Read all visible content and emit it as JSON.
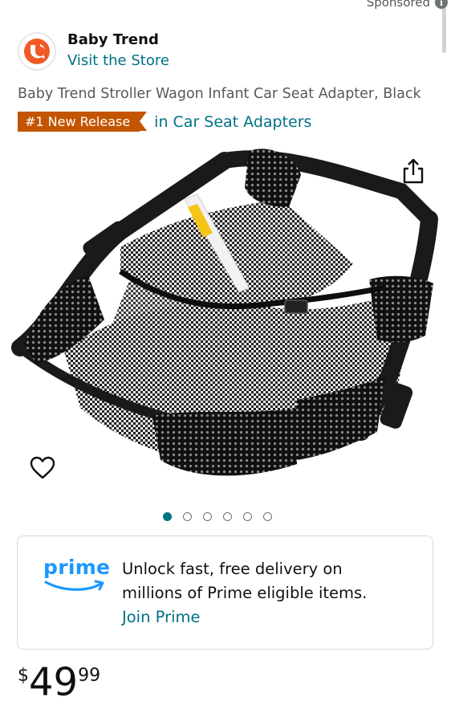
{
  "header": {
    "sponsored_label": "Sponsored",
    "info_symbol": "i"
  },
  "brand": {
    "name": "Baby Trend",
    "visit_store": "Visit the Store",
    "logo_color": "#f15a24"
  },
  "product": {
    "title": "Baby Trend Stroller Wagon Infant Car Seat Adapter, Black",
    "badge": "#1 New Release",
    "badge_color": "#c45500",
    "category_link": "in Car Seat Adapters",
    "image_icon": "car-seat-adapter-mesh-image"
  },
  "carousel": {
    "total": 6,
    "active_index": 0
  },
  "prime": {
    "logo_text": "prime",
    "line1": "Unlock fast, free delivery on",
    "line2": "millions of Prime eligible items.",
    "join_label": "Join Prime",
    "brand_color": "#1a98ff"
  },
  "price": {
    "symbol": "$",
    "whole": "49",
    "fraction": "99"
  },
  "colors": {
    "link": "#007185",
    "text": "#0f1111",
    "muted": "#565959"
  }
}
